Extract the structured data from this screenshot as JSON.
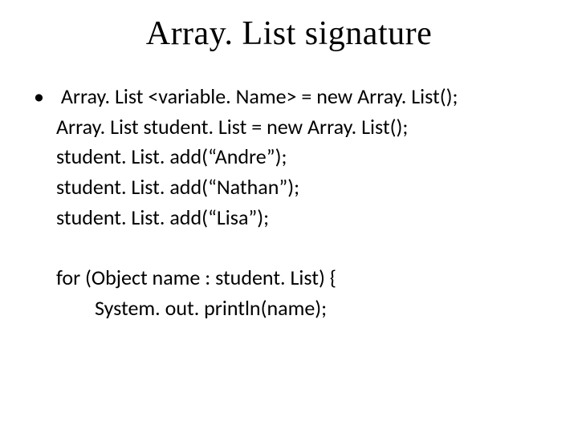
{
  "title": "Array. List signature",
  "bullet_glyph": "•",
  "lines": [
    {
      "text": " Array. List <variable. Name> = new Array. List();",
      "indent": 0
    },
    {
      "text": "Array. List student. List = new Array. List();",
      "indent": 1
    },
    {
      "text": "student. List. add(“Andre”);",
      "indent": 1
    },
    {
      "text": "student. List. add(“Nathan”);",
      "indent": 1
    },
    {
      "text": "student. List. add(“Lisa”);",
      "indent": 1
    },
    {
      "text": "",
      "indent": 1,
      "gap": true
    },
    {
      "text": "for (Object name : student. List) {",
      "indent": 1
    },
    {
      "text": "System. out. println(name);",
      "indent": 2
    }
  ]
}
